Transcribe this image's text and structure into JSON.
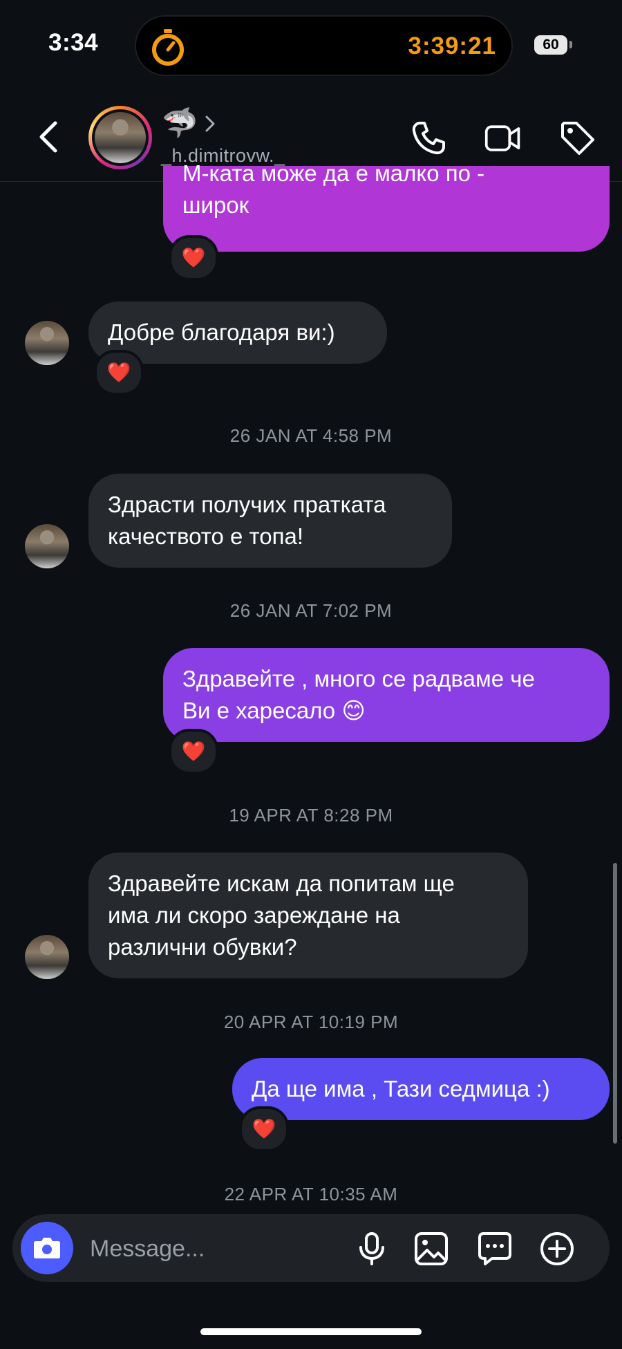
{
  "status": {
    "time": "3:34",
    "timer": "3:39:21",
    "battery": "60"
  },
  "header": {
    "emoji": "🦈",
    "username": "_h.dimitrovw._"
  },
  "messages": [
    {
      "from": "me",
      "lines": [
        "М-ката може да е малко по -",
        "широк"
      ],
      "reaction": "❤️"
    },
    {
      "from": "them",
      "lines": [
        "Добре благодаря ви:)"
      ],
      "reaction": "❤️"
    },
    {
      "timestamp": "26 JAN AT 4:58 PM"
    },
    {
      "from": "them",
      "lines": [
        "Здрасти получих пратката",
        "качеството е топа!"
      ]
    },
    {
      "timestamp": "26 JAN AT 7:02 PM"
    },
    {
      "from": "me",
      "lines": [
        "Здравейте , много се радваме че",
        "Ви е харесало 😊"
      ],
      "reaction": "❤️"
    },
    {
      "timestamp": "19 APR AT 8:28 PM"
    },
    {
      "from": "them",
      "lines": [
        "Здравейте искам да попитам ще",
        "има ли скоро зареждане на",
        "различни обувки?"
      ]
    },
    {
      "timestamp": "20 APR AT 10:19 PM"
    },
    {
      "from": "me",
      "lines": [
        "Да ще има , Тази седмица :)"
      ],
      "reaction": "❤️"
    },
    {
      "timestamp": "22 APR AT 10:35 AM"
    }
  ],
  "composer": {
    "placeholder": "Message..."
  },
  "icons": [
    "timer-icon",
    "back-icon",
    "chevron-right-icon",
    "phone-icon",
    "video-icon",
    "tag-icon",
    "camera-icon",
    "microphone-icon",
    "gallery-icon",
    "sticker-chat-icon",
    "plus-icon"
  ]
}
